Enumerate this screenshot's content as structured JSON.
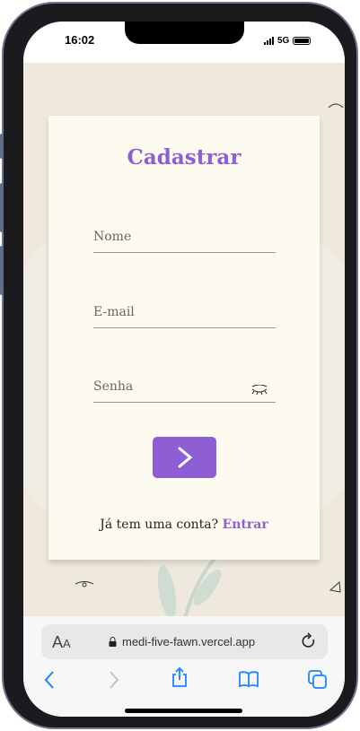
{
  "status_bar": {
    "time": "16:02",
    "network": "5G"
  },
  "form": {
    "title": "Cadastrar",
    "fields": [
      {
        "placeholder": "Nome"
      },
      {
        "placeholder": "E-mail"
      },
      {
        "placeholder": "Senha"
      }
    ],
    "submit_icon": "chevron-right-icon",
    "footer_text": "Já tem uma conta?",
    "footer_link": "Entrar"
  },
  "browser": {
    "text_size_label": "A",
    "text_size_label_small": "A",
    "url": "medi-five-fawn.vercel.app"
  },
  "colors": {
    "accent": "#8e5fd4",
    "page_bg": "#efe8dd",
    "card_bg": "#fdfbef",
    "ios_blue": "#1a84ff"
  }
}
